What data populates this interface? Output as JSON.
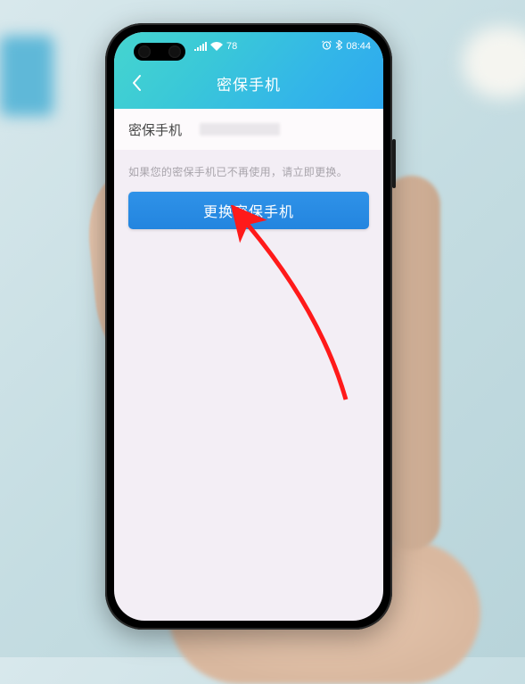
{
  "status_bar": {
    "carrier_label": "",
    "battery_label": "78",
    "time": "08:44"
  },
  "header": {
    "title": "密保手机"
  },
  "info_row": {
    "label": "密保手机"
  },
  "hint": "如果您的密保手机已不再使用，请立即更换。",
  "action": {
    "label": "更换密保手机"
  }
}
